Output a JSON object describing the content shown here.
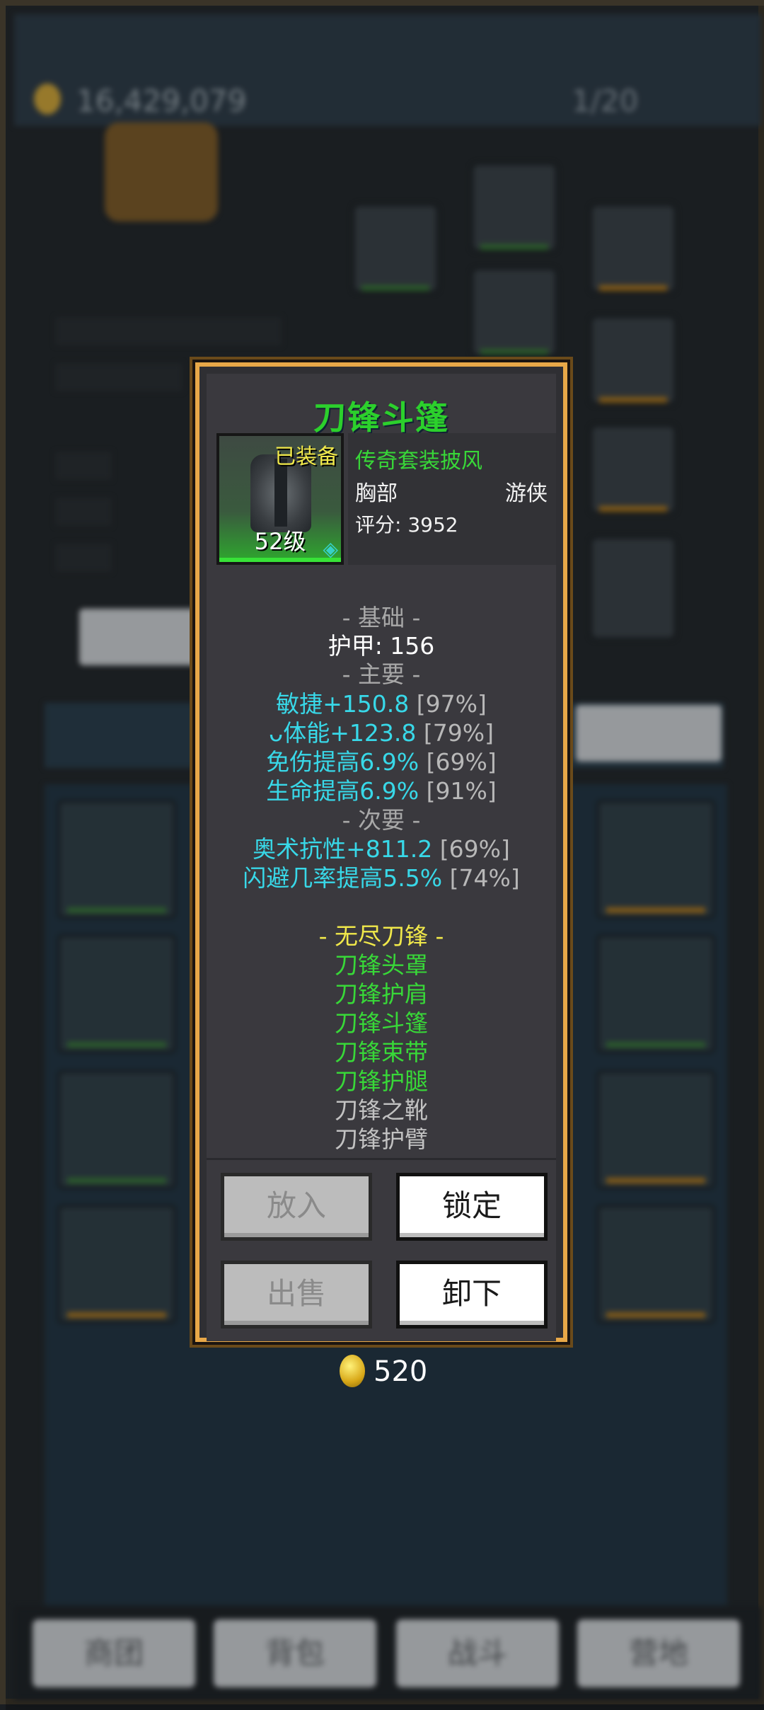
{
  "background": {
    "gold": "16,429,079",
    "bag_capacity": "1/20",
    "nav": [
      "商团",
      "背包",
      "战斗",
      "营地"
    ]
  },
  "item": {
    "name": "刀锋斗篷",
    "equipped_label": "已装备",
    "level_label": "52级",
    "set_type": "传奇套装披风",
    "slot": "胸部",
    "class": "游侠",
    "score_label": "评分:",
    "score_value": "3952"
  },
  "stats": {
    "basic_header": "- 基础 -",
    "armor": "护甲: 156",
    "main_header": "- 主要 -",
    "main": [
      {
        "text": "敏捷+150.8",
        "pct": "[97%]"
      },
      {
        "text": "ᴗ体能+123.8",
        "pct": "[79%]"
      },
      {
        "text": "免伤提高6.9%",
        "pct": "[69%]"
      },
      {
        "text": "生命提高6.9%",
        "pct": "[91%]"
      }
    ],
    "secondary_header": "- 次要 -",
    "secondary": [
      {
        "text": "奥术抗性+811.2",
        "pct": "[69%]"
      },
      {
        "text": "闪避几率提高5.5%",
        "pct": "[74%]"
      }
    ]
  },
  "set": {
    "header": "- 无尽刀锋 -",
    "pieces_owned": [
      "刀锋头罩",
      "刀锋护肩",
      "刀锋斗篷",
      "刀锋束带",
      "刀锋护腿"
    ],
    "pieces_missing": [
      "刀锋之靴",
      "刀锋护臂"
    ]
  },
  "buttons": {
    "put_in": "放入",
    "lock": "锁定",
    "sell": "出售",
    "unequip": "卸下"
  },
  "sell_price": "520",
  "colors": {
    "title_green": "#2cd02c",
    "stat_cyan": "#38d8e8",
    "set_yellow": "#f0e84a",
    "frame_gold": "#e8a848"
  }
}
